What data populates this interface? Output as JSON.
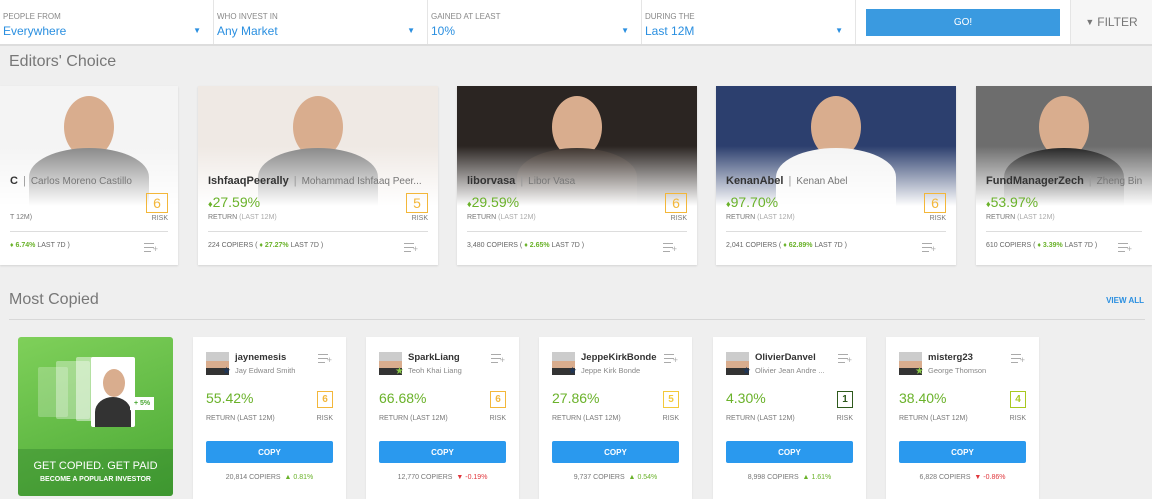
{
  "filters": [
    {
      "label": "PEOPLE FROM",
      "value": "Everywhere"
    },
    {
      "label": "WHO INVEST IN",
      "value": "Any Market"
    },
    {
      "label": "GAINED AT LEAST",
      "value": "10%"
    },
    {
      "label": "DURING THE",
      "value": "Last 12M"
    }
  ],
  "go_label": "GO!",
  "filter_label": "FILTER",
  "editors_title": "Editors' Choice",
  "most_copied_title": "Most Copied",
  "view_all": "VIEW ALL",
  "colors": {
    "accent": "#2a99ee",
    "positive": "#6ab22a",
    "negative": "#e0363c",
    "risk": "#f3b73a"
  },
  "editors": [
    {
      "user": "C",
      "full": "Carlos Moreno Castillo",
      "ret": "",
      "ret_label": "T 12M)",
      "risk": "6",
      "copiers_pre": "",
      "change": "6.74%",
      "copiers_post": "LAST 7D )",
      "photo": "#f4f4f4"
    },
    {
      "user": "IshfaaqPeerally",
      "full": "Mohammad Ishfaaq Peer...",
      "ret": "27.59%",
      "ret_label": "RETURN",
      "ret_label2": "(LAST 12M)",
      "risk": "5",
      "copiers_pre": "224 COPIERS (",
      "change": "27.27%",
      "copiers_post": "LAST 7D )",
      "photo": "#efe9e4"
    },
    {
      "user": "liborvasa",
      "full": "Libor Vasa",
      "ret": "29.59%",
      "ret_label": "RETURN",
      "ret_label2": "(LAST 12M)",
      "risk": "6",
      "copiers_pre": "3,480 COPIERS (",
      "change": "2.65%",
      "copiers_post": "LAST 7D )",
      "photo": "#2b2522"
    },
    {
      "user": "KenanAbel",
      "full": "Kenan Abel",
      "ret": "97.70%",
      "ret_label": "RETURN",
      "ret_label2": "(LAST 12M)",
      "risk": "6",
      "copiers_pre": "2,041 COPIERS (",
      "change": "62.89%",
      "copiers_post": "LAST 7D )",
      "photo": "#2c3f6e"
    },
    {
      "user": "FundManagerZech",
      "full": "Zheng Bin",
      "ret": "53.97%",
      "ret_label": "RETURN",
      "ret_label2": "(LAST 12M)",
      "risk": "",
      "copiers_pre": "610 COPIERS (",
      "change": "3.39%",
      "copiers_post": "LAST 7D )",
      "photo": "#6d6d6d"
    }
  ],
  "risk_label": "RISK",
  "promo": {
    "title": "GET COPIED. GET PAID",
    "subtitle": "BECOME A POPULAR INVESTOR",
    "badge": "+ 5%"
  },
  "most_copied": [
    {
      "user": "jaynemesis",
      "full": "Jay Edward Smith",
      "ret": "55.42%",
      "risk": "6",
      "risk_color": "#f3b73a",
      "copiers": "20,814 COPIERS",
      "change": "0.81%",
      "dir": "up",
      "star": "#1f3556"
    },
    {
      "user": "SparkLiang",
      "full": "Teoh Khai Liang",
      "ret": "66.68%",
      "risk": "6",
      "risk_color": "#f3b73a",
      "copiers": "12,770 COPIERS",
      "change": "-0.19%",
      "dir": "down",
      "star": "#8bc84a"
    },
    {
      "user": "JeppeKirkBonde",
      "full": "Jeppe Kirk Bonde",
      "ret": "27.86%",
      "risk": "5",
      "risk_color": "#f3c93a",
      "copiers": "9,737 COPIERS",
      "change": "0.54%",
      "dir": "up",
      "star": "#1f3556"
    },
    {
      "user": "OlivierDanvel",
      "full": "Olivier Jean Andre ...",
      "ret": "4.30%",
      "risk": "1",
      "risk_color": "#2e5a1c",
      "copiers": "8,998 COPIERS",
      "change": "1.61%",
      "dir": "up",
      "star": "#1f3556"
    },
    {
      "user": "misterg23",
      "full": "George Thomson",
      "ret": "38.40%",
      "risk": "4",
      "risk_color": "#a8c820",
      "copiers": "6,828 COPIERS",
      "change": "-0.86%",
      "dir": "down",
      "star": "#8bc84a"
    }
  ],
  "mc_return_label": "RETURN (LAST 12M)",
  "copy_label": "COPY"
}
